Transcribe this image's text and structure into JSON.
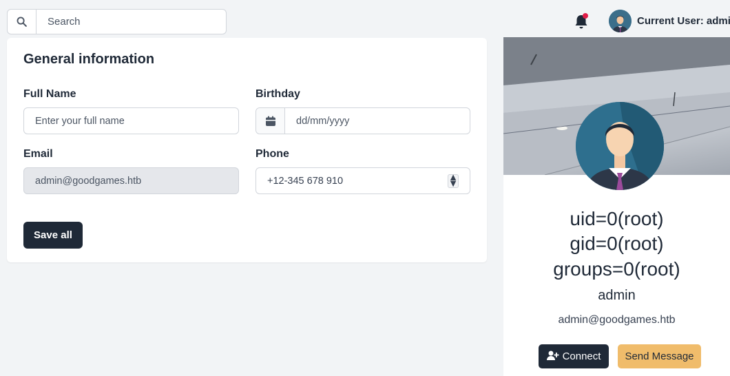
{
  "search": {
    "placeholder": "Search",
    "icon": "search-icon"
  },
  "header": {
    "notification_icon": "bell-icon",
    "notification_dot_color": "#e11d48",
    "current_user_label": "Current User: admin"
  },
  "general": {
    "title": "General information",
    "full_name": {
      "label": "Full Name",
      "placeholder": "Enter your full name",
      "value": ""
    },
    "birthday": {
      "label": "Birthday",
      "placeholder": "dd/mm/yyyy",
      "icon": "calendar-icon"
    },
    "email": {
      "label": "Email",
      "value": "admin@goodgames.htb"
    },
    "phone": {
      "label": "Phone",
      "value": "+12-345 678 910"
    },
    "save_label": "Save all"
  },
  "profile": {
    "name_lines": [
      "uid=0(root)",
      "gid=0(root)",
      "groups=0(root)"
    ],
    "username": "admin",
    "email": "admin@goodgames.htb",
    "connect_label": "Connect",
    "message_label": "Send Message",
    "accent_color": "#f0bc6b",
    "dark_color": "#1f2937"
  }
}
